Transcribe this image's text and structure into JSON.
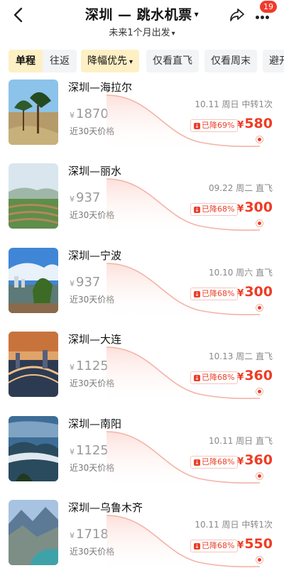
{
  "header": {
    "title": "深圳 — 跳水机票",
    "title_caret": "▾",
    "subtitle": "未来1个月出发",
    "subtitle_caret": "▾",
    "badge_count": "19",
    "icons": [
      "back-arrow-icon",
      "share-icon",
      "more-dots-icon"
    ]
  },
  "filters": {
    "trip_type": [
      "单程",
      "往返"
    ],
    "active_trip": "单程",
    "sort_label": "降幅优先",
    "sort_caret": "▾",
    "chips": [
      "仅看直飞",
      "仅看周末",
      "避开"
    ]
  },
  "labels": {
    "currency": "¥",
    "drop_arrow": "↓",
    "orig_label": "近30天价格"
  },
  "colors": {
    "accent": "#ef3b24",
    "highlight_chip": "#fdf0c4",
    "chip_bg": "#f3f4f6",
    "badge": "#f23a2b"
  },
  "flights": [
    {
      "route": "深圳—海拉尔",
      "orig_price": "1870",
      "date": "10.11 周日",
      "stop": "中转1次",
      "drop": "已降69%",
      "price": "580"
    },
    {
      "route": "深圳—丽水",
      "orig_price": "937",
      "date": "09.22 周二",
      "stop": "直飞",
      "drop": "已降68%",
      "price": "300"
    },
    {
      "route": "深圳—宁波",
      "orig_price": "937",
      "date": "10.10 周六",
      "stop": "直飞",
      "drop": "已降68%",
      "price": "300"
    },
    {
      "route": "深圳—大连",
      "orig_price": "1125",
      "date": "10.13 周二",
      "stop": "直飞",
      "drop": "已降68%",
      "price": "360"
    },
    {
      "route": "深圳—南阳",
      "orig_price": "1125",
      "date": "10.11 周日",
      "stop": "直飞",
      "drop": "已降68%",
      "price": "360"
    },
    {
      "route": "深圳—乌鲁木齐",
      "orig_price": "1718",
      "date": "10.11 周日",
      "stop": "中转1次",
      "drop": "已降68%",
      "price": "550"
    }
  ]
}
